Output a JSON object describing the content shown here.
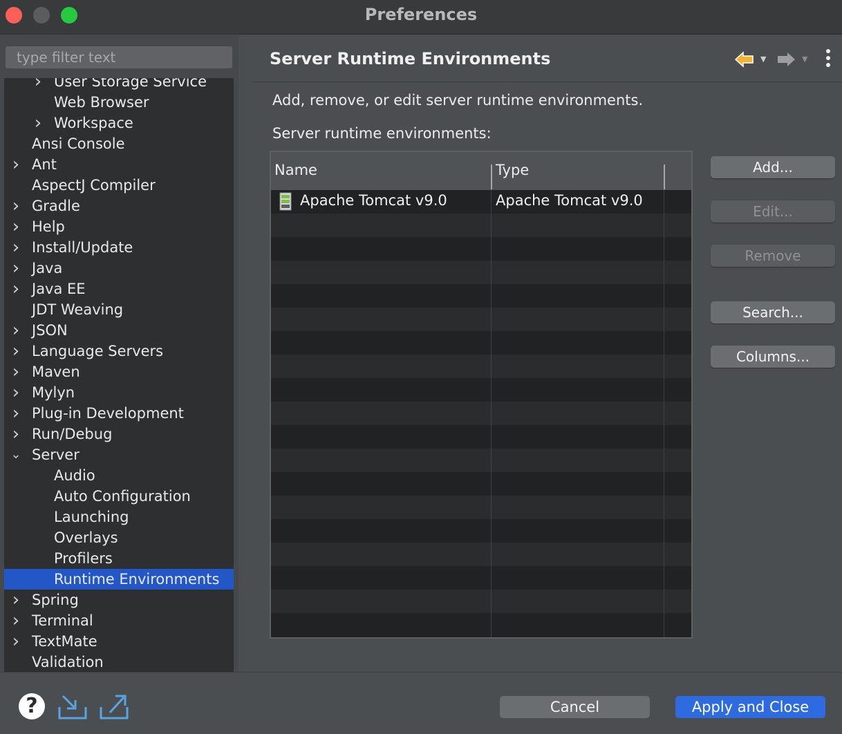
{
  "window": {
    "title": "Preferences"
  },
  "sidebar": {
    "filter_placeholder": "type filter text",
    "items": [
      {
        "label": "User Storage Service",
        "level": 1,
        "expandable": true,
        "expanded": false,
        "selected": false
      },
      {
        "label": "Web Browser",
        "level": 1,
        "expandable": false,
        "expanded": false,
        "selected": false
      },
      {
        "label": "Workspace",
        "level": 1,
        "expandable": true,
        "expanded": false,
        "selected": false
      },
      {
        "label": "Ansi Console",
        "level": 0,
        "expandable": false,
        "expanded": false,
        "selected": false
      },
      {
        "label": "Ant",
        "level": 0,
        "expandable": true,
        "expanded": false,
        "selected": false
      },
      {
        "label": "AspectJ Compiler",
        "level": 0,
        "expandable": false,
        "expanded": false,
        "selected": false
      },
      {
        "label": "Gradle",
        "level": 0,
        "expandable": true,
        "expanded": false,
        "selected": false
      },
      {
        "label": "Help",
        "level": 0,
        "expandable": true,
        "expanded": false,
        "selected": false
      },
      {
        "label": "Install/Update",
        "level": 0,
        "expandable": true,
        "expanded": false,
        "selected": false
      },
      {
        "label": "Java",
        "level": 0,
        "expandable": true,
        "expanded": false,
        "selected": false
      },
      {
        "label": "Java EE",
        "level": 0,
        "expandable": true,
        "expanded": false,
        "selected": false
      },
      {
        "label": "JDT Weaving",
        "level": 0,
        "expandable": false,
        "expanded": false,
        "selected": false
      },
      {
        "label": "JSON",
        "level": 0,
        "expandable": true,
        "expanded": false,
        "selected": false
      },
      {
        "label": "Language Servers",
        "level": 0,
        "expandable": true,
        "expanded": false,
        "selected": false
      },
      {
        "label": "Maven",
        "level": 0,
        "expandable": true,
        "expanded": false,
        "selected": false
      },
      {
        "label": "Mylyn",
        "level": 0,
        "expandable": true,
        "expanded": false,
        "selected": false
      },
      {
        "label": "Plug-in Development",
        "level": 0,
        "expandable": true,
        "expanded": false,
        "selected": false
      },
      {
        "label": "Run/Debug",
        "level": 0,
        "expandable": true,
        "expanded": false,
        "selected": false
      },
      {
        "label": "Server",
        "level": 0,
        "expandable": true,
        "expanded": true,
        "selected": false
      },
      {
        "label": "Audio",
        "level": 1,
        "expandable": false,
        "expanded": false,
        "selected": false
      },
      {
        "label": "Auto Configuration",
        "level": 1,
        "expandable": false,
        "expanded": false,
        "selected": false
      },
      {
        "label": "Launching",
        "level": 1,
        "expandable": false,
        "expanded": false,
        "selected": false
      },
      {
        "label": "Overlays",
        "level": 1,
        "expandable": false,
        "expanded": false,
        "selected": false
      },
      {
        "label": "Profilers",
        "level": 1,
        "expandable": false,
        "expanded": false,
        "selected": false
      },
      {
        "label": "Runtime Environments",
        "level": 1,
        "expandable": false,
        "expanded": false,
        "selected": true
      },
      {
        "label": "Spring",
        "level": 0,
        "expandable": true,
        "expanded": false,
        "selected": false
      },
      {
        "label": "Terminal",
        "level": 0,
        "expandable": true,
        "expanded": false,
        "selected": false
      },
      {
        "label": "TextMate",
        "level": 0,
        "expandable": true,
        "expanded": false,
        "selected": false
      },
      {
        "label": "Validation",
        "level": 0,
        "expandable": false,
        "expanded": false,
        "selected": false
      }
    ]
  },
  "page": {
    "title": "Server Runtime Environments",
    "description": "Add, remove, or edit server runtime environments.",
    "list_label": "Server runtime environments:",
    "table": {
      "columns": [
        "Name",
        "Type"
      ],
      "rows": [
        {
          "name": "Apache Tomcat v9.0",
          "type": "Apache Tomcat v9.0",
          "icon": "server-icon"
        }
      ],
      "visible_rows": 19
    },
    "buttons": {
      "add": "Add...",
      "edit": "Edit...",
      "remove": "Remove",
      "search": "Search...",
      "columns": "Columns..."
    }
  },
  "footer": {
    "cancel": "Cancel",
    "apply_and_close": "Apply and Close"
  },
  "colors": {
    "selection": "#2357c7",
    "primary_button": "#2e6be0",
    "back_arrow": "#f2b233"
  }
}
